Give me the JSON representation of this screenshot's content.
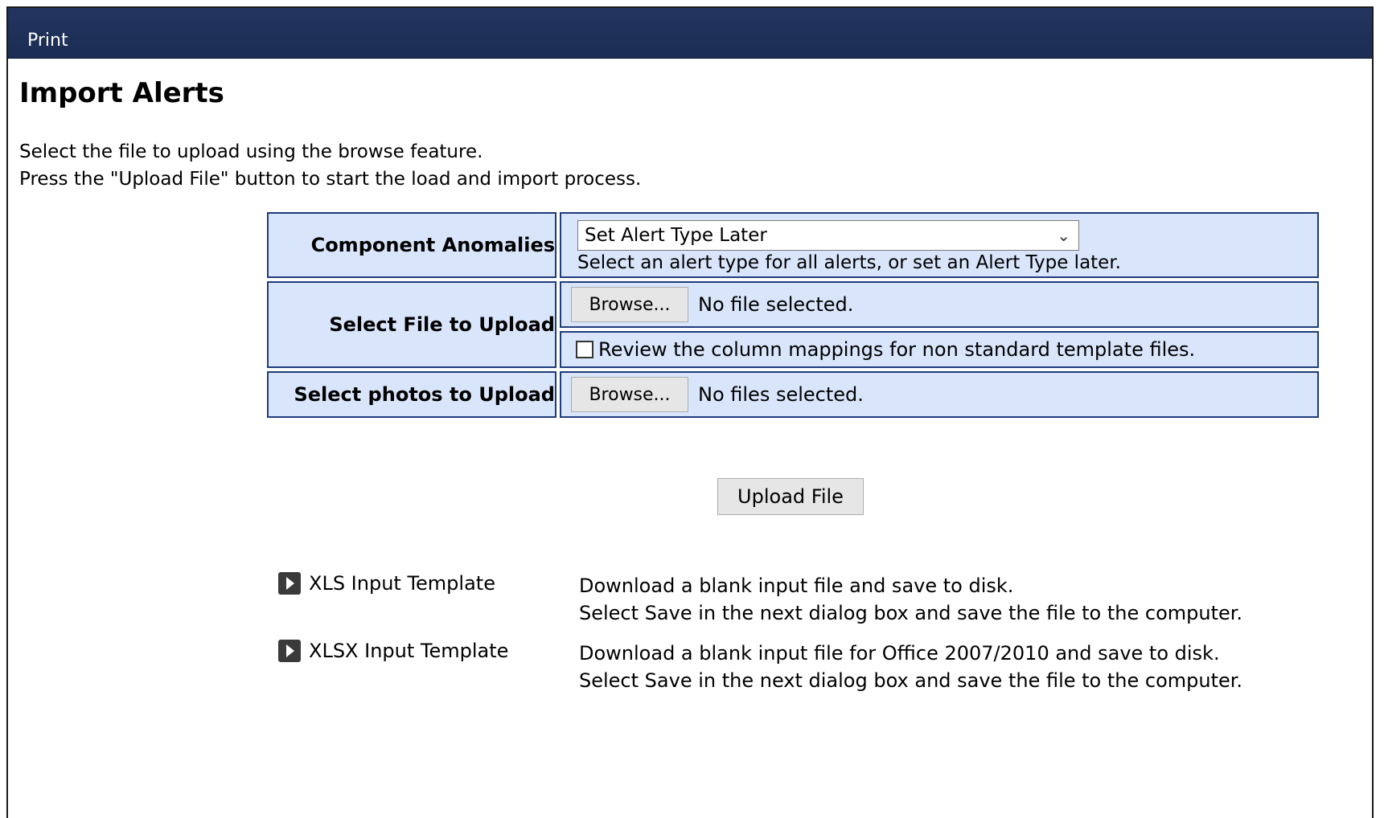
{
  "header": {
    "print_label": "Print"
  },
  "page": {
    "title": "Import Alerts",
    "instructions": [
      "Select the file to upload using the browse feature.",
      "Press the \"Upload File\" button to start the load and import process."
    ]
  },
  "form": {
    "component_anomalies": {
      "label": "Component Anomalies",
      "selected": "Set Alert Type Later",
      "hint": "Select an alert type for all alerts, or set an Alert Type later."
    },
    "file_upload": {
      "label": "Select File to Upload",
      "browse_label": "Browse...",
      "status": "No file selected.",
      "review_label": "Review the column mappings for non standard template files."
    },
    "photos_upload": {
      "label": "Select photos to Upload",
      "browse_label": "Browse...",
      "status": "No files selected."
    },
    "upload_button": "Upload File"
  },
  "templates": [
    {
      "name": "XLS Input Template",
      "desc1": "Download a blank input file and save to disk.",
      "desc2": "Select Save in the next dialog box and save the file to the computer."
    },
    {
      "name": "XLSX Input Template",
      "desc1": "Download a blank input file for Office 2007/2010 and save to disk.",
      "desc2": "Select Save in the next dialog box and save the file to the computer."
    }
  ]
}
